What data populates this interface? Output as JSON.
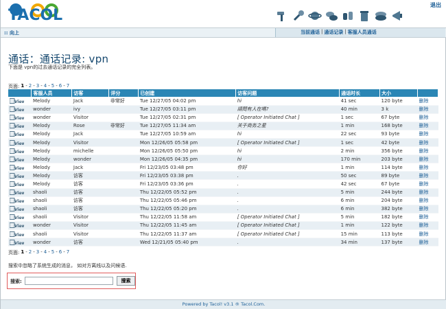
{
  "header": {
    "logo_text": "TACOL",
    "logout": "退出",
    "toolbar_icons": [
      "hammer-icon",
      "wrench-icon",
      "planet-icon",
      "chat-bubbles-icon",
      "cups-icon",
      "trash-icon",
      "boxes-icon",
      "megaphone-icon"
    ]
  },
  "nav": {
    "up": ":: 向上",
    "links": [
      "当前通话",
      "通话记录",
      "客服人员通话"
    ],
    "sep": "|"
  },
  "page": {
    "title": "通话：通话记录: vpn",
    "subtitle": "下面是 vpn的过去通话记录的完全列表。"
  },
  "pager": {
    "label": "页面:",
    "current": "1",
    "pages": [
      "2",
      "3",
      "4",
      "5",
      "6",
      "7"
    ]
  },
  "table": {
    "columns": [
      "",
      "客服人员",
      "访客",
      "评分",
      "已创建",
      "访客问题",
      "通话时长",
      "大小",
      ""
    ],
    "view_label": "View",
    "delete_label": "删除",
    "rows": [
      {
        "operator": "Melody",
        "visitor": "Jack",
        "rating": "非常好",
        "created": "Tue 12/27/05 04:02 pm",
        "question": "hi",
        "duration": "41 sec",
        "size": "120 byte"
      },
      {
        "operator": "wonder",
        "visitor": "ivy",
        "rating": "",
        "created": "Tue 12/27/05 03:11 pm",
        "question": "請問有人在嗎?",
        "duration": "40 min",
        "size": "3 k"
      },
      {
        "operator": "wonder",
        "visitor": "Visitor",
        "rating": "",
        "created": "Tue 12/27/05 02:31 pm",
        "question": "[ Operator Initiated Chat ]",
        "duration": "1 sec",
        "size": "67 byte"
      },
      {
        "operator": "Melody",
        "visitor": "Rose",
        "rating": "非常好",
        "created": "Tue 12/27/05 11:34 am",
        "question": "关于商务之星",
        "duration": "1 min",
        "size": "168 byte"
      },
      {
        "operator": "Melody",
        "visitor": "Jack",
        "rating": "",
        "created": "Tue 12/27/05 10:59 am",
        "question": "hi",
        "duration": "22 sec",
        "size": "93 byte"
      },
      {
        "operator": "Melody",
        "visitor": "Visitor",
        "rating": "",
        "created": "Mon 12/26/05 05:58 pm",
        "question": "[ Operator Initiated Chat ]",
        "duration": "1 sec",
        "size": "42 byte"
      },
      {
        "operator": "Melody",
        "visitor": "michelle",
        "rating": "",
        "created": "Mon 12/26/05 05:50 pm",
        "question": "hi",
        "duration": "2 min",
        "size": "356 byte"
      },
      {
        "operator": "Melody",
        "visitor": "wonder",
        "rating": "",
        "created": "Mon 12/26/05 04:35 pm",
        "question": "hi",
        "duration": "170 min",
        "size": "203 byte"
      },
      {
        "operator": "Melody",
        "visitor": "Jack",
        "rating": "",
        "created": "Fri 12/23/05 03:48 pm",
        "question": "你好",
        "duration": "1 min",
        "size": "114 byte"
      },
      {
        "operator": "Melody",
        "visitor": "访客",
        "rating": "",
        "created": "Fri 12/23/05 03:38 pm",
        "question": ".",
        "duration": "50 sec",
        "size": "89 byte"
      },
      {
        "operator": "Melody",
        "visitor": "访客",
        "rating": "",
        "created": "Fri 12/23/05 03:36 pm",
        "question": ".",
        "duration": "42 sec",
        "size": "67 byte"
      },
      {
        "operator": "shaoli",
        "visitor": "访客",
        "rating": "",
        "created": "Thu 12/22/05 05:52 pm",
        "question": ".",
        "duration": "5 min",
        "size": "244 byte"
      },
      {
        "operator": "shaoli",
        "visitor": "访客",
        "rating": "",
        "created": "Thu 12/22/05 05:46 pm",
        "question": ".",
        "duration": "6 min",
        "size": "204 byte"
      },
      {
        "operator": "shaoli",
        "visitor": "访客",
        "rating": "",
        "created": "Thu 12/22/05 05:20 pm",
        "question": ".",
        "duration": "6 min",
        "size": "382 byte"
      },
      {
        "operator": "shaoli",
        "visitor": "Visitor",
        "rating": "",
        "created": "Thu 12/22/05 11:58 am",
        "question": "[ Operator Initiated Chat ]",
        "duration": "5 min",
        "size": "182 byte"
      },
      {
        "operator": "wonder",
        "visitor": "Visitor",
        "rating": "",
        "created": "Thu 12/22/05 11:45 am",
        "question": "[ Operator Initiated Chat ]",
        "duration": "1 min",
        "size": "122 byte"
      },
      {
        "operator": "shaoli",
        "visitor": "Visitor",
        "rating": "",
        "created": "Thu 12/22/05 11:37 am",
        "question": "[ Operator Initiated Chat ]",
        "duration": "15 min",
        "size": "113 byte"
      },
      {
        "operator": "wonder",
        "visitor": "访客",
        "rating": "",
        "created": "Wed 12/21/05 05:40 pm",
        "question": ".",
        "duration": "34 min",
        "size": "137 byte"
      }
    ]
  },
  "note": "搜索中忽略了系统生成的消息，  如对方离线以及问候语.",
  "search": {
    "label": "搜索:",
    "value": "",
    "placeholder": "",
    "button": "搜索"
  },
  "footer": {
    "text": "Powered by Tacol! v3.1 ® Tacol.Com."
  }
}
